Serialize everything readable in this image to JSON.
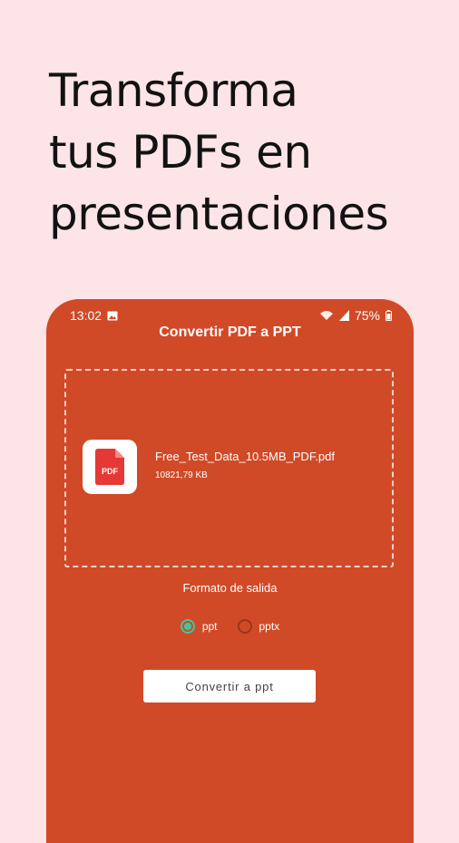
{
  "hero": {
    "line1": "Transforma",
    "line2": "tus PDFs en",
    "line3": "presentaciones"
  },
  "status_bar": {
    "time": "13:02",
    "battery": "75%"
  },
  "app": {
    "title": "Convertir PDF a PPT",
    "file": {
      "icon_text": "PDF",
      "name": "Free_Test_Data_10.5MB_PDF.pdf",
      "size": "10821,79 KB"
    },
    "format_label": "Formato de salida",
    "options": [
      {
        "label": "ppt",
        "selected": true
      },
      {
        "label": "pptx",
        "selected": false
      }
    ],
    "convert_label": "Convertir a ppt"
  },
  "colors": {
    "background": "#fde4e6",
    "app_background": "#d04a27",
    "accent": "#39c9a4",
    "pdf_red": "#e53935"
  }
}
